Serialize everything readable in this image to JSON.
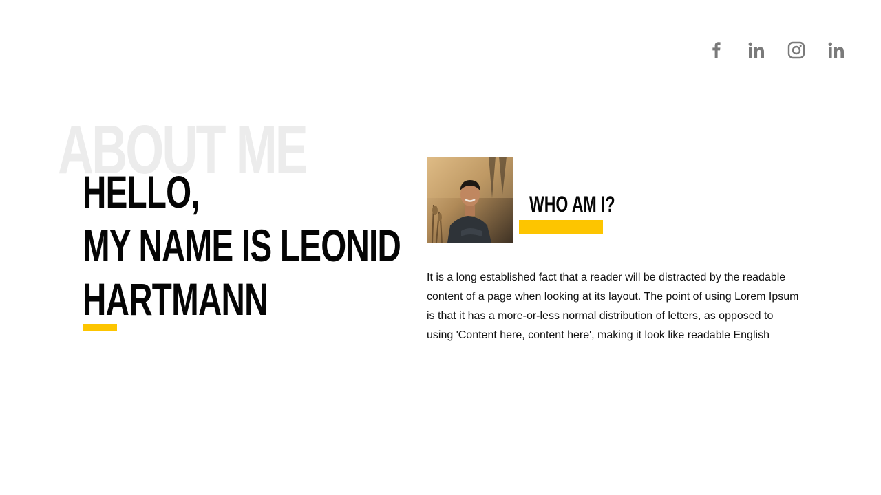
{
  "social": {
    "links": [
      {
        "name": "facebook",
        "icon": "facebook-icon"
      },
      {
        "name": "linkedin",
        "icon": "linkedin-icon"
      },
      {
        "name": "instagram",
        "icon": "instagram-icon"
      },
      {
        "name": "linkedin",
        "icon": "linkedin-icon"
      }
    ],
    "icon_color": "#7a7a7a"
  },
  "about": {
    "background_title": "ABOUT ME",
    "hero_lines": [
      "HELLO,",
      "MY NAME IS LEONID",
      "HARTMANN"
    ],
    "accent_color": "#fdc500"
  },
  "profile": {
    "photo_icon": "profile-photo",
    "who_title": "WHO AM I?",
    "description": "It is a long established fact that a reader will be distracted by the readable content of a page when looking at its layout. The point of using Lorem Ipsum is that it has a more-or-less normal distribution of letters, as opposed to using 'Content here, content here', making it look like readable English"
  }
}
